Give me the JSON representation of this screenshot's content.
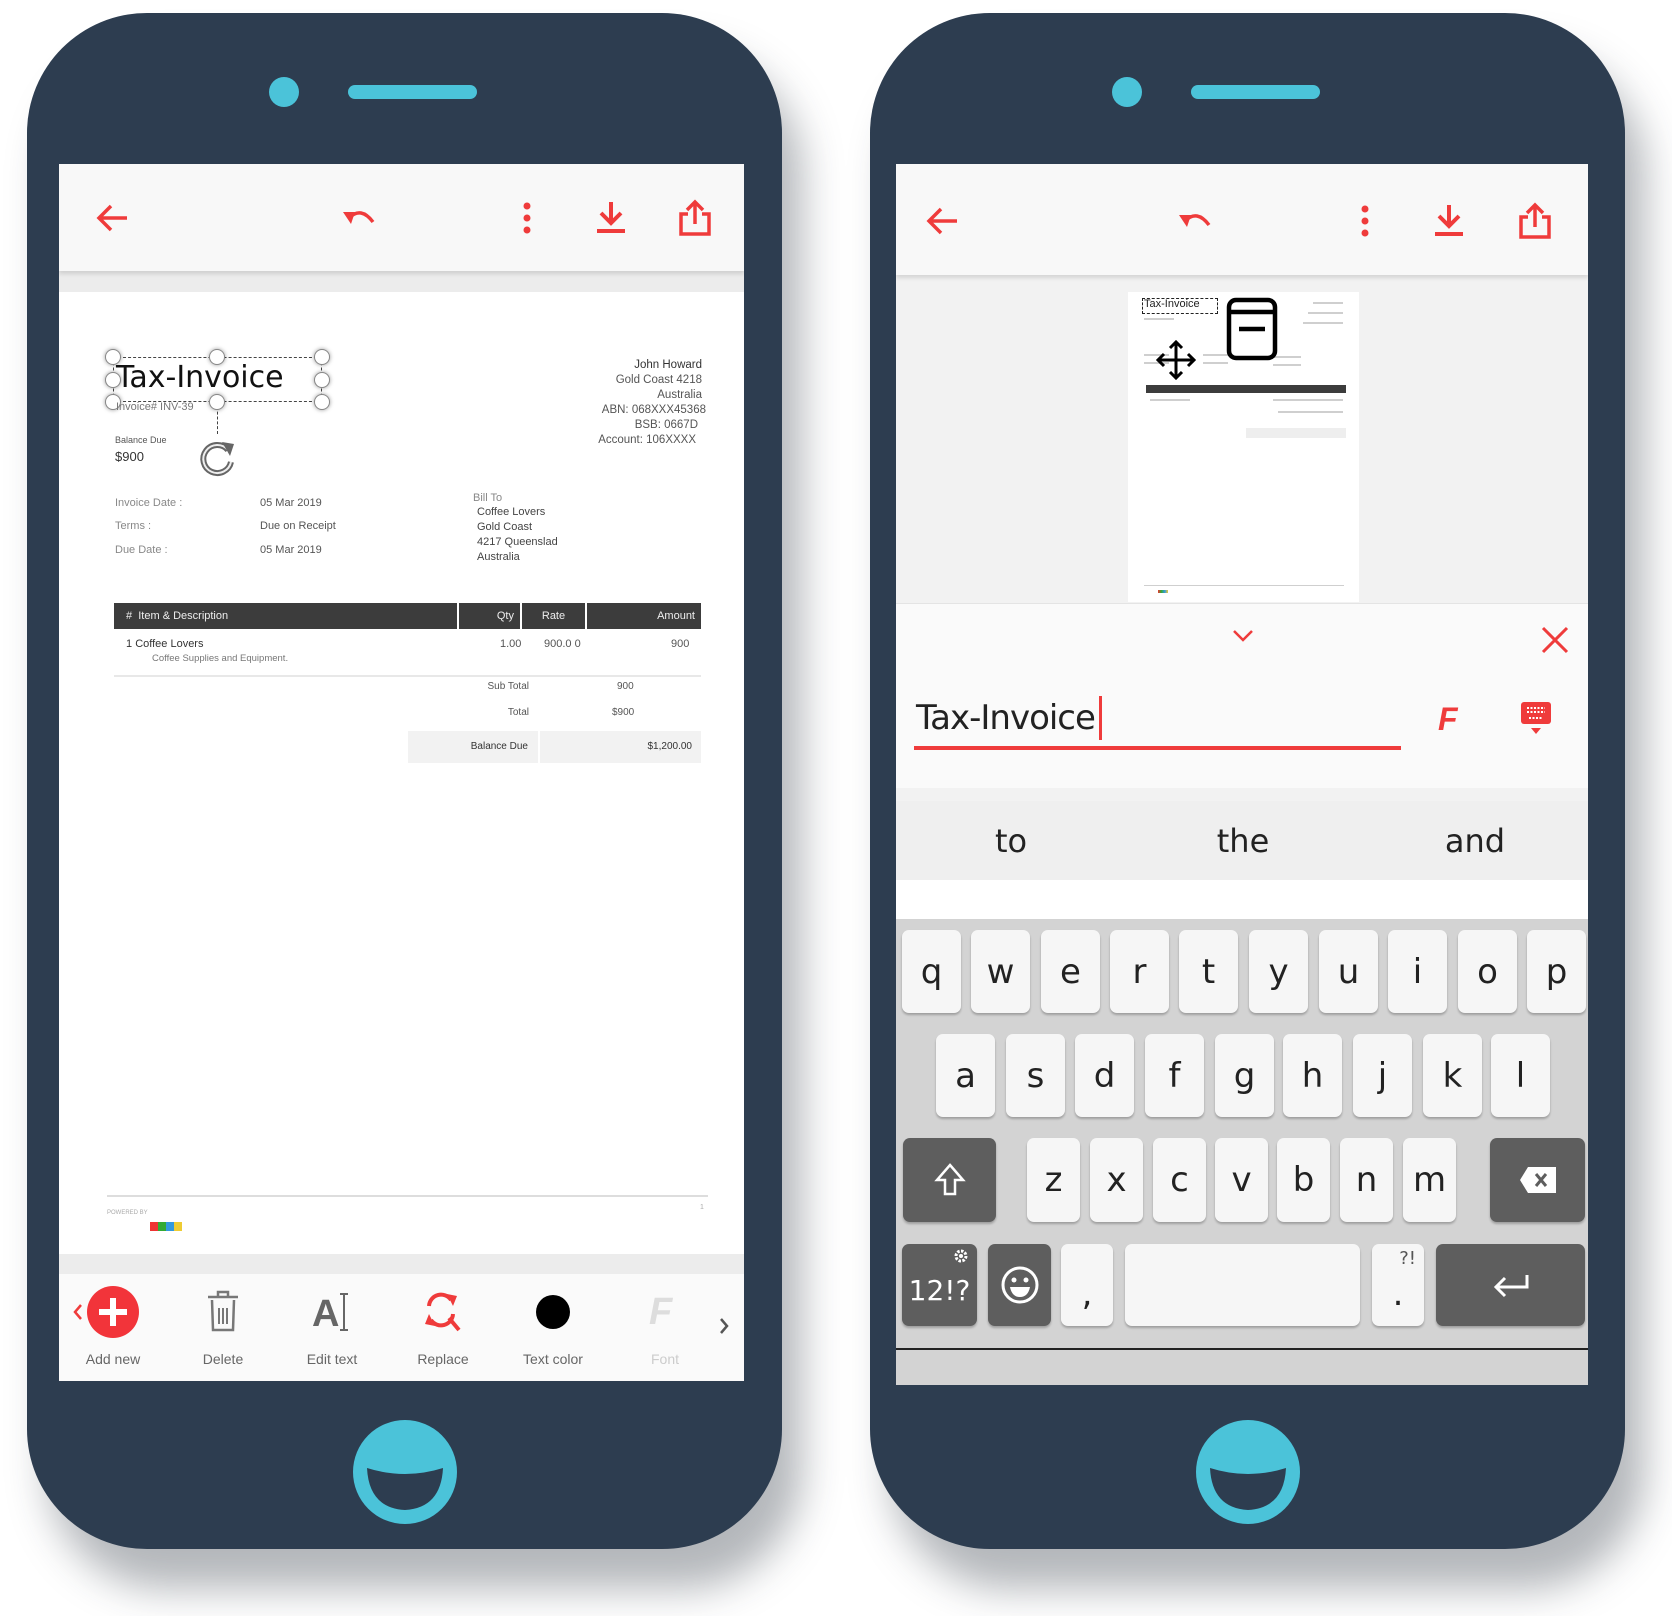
{
  "colors": {
    "accent": "#ef3b3b",
    "phone": "#2d3d50",
    "phone_accent": "#4bc3d9",
    "table_header": "#3c3c3c"
  },
  "toolbar": {
    "icons": [
      "back-arrow-icon",
      "undo-icon",
      "more-vertical-icon",
      "download-icon",
      "share-icon"
    ]
  },
  "invoice": {
    "title": "Tax-Invoice",
    "number": "Invoice# INV-39",
    "balance_label": "Balance Due",
    "balance_value": "$900",
    "address": [
      "John Howard",
      "Gold Coast  4218",
      "Australia",
      "ABN: 068XXX45368",
      "BSB: 0667D",
      "Account: 106XXXX"
    ],
    "meta": [
      {
        "label": "Invoice Date :",
        "value": "05 Mar 2019"
      },
      {
        "label": "Terms :",
        "value": "Due on Receipt"
      },
      {
        "label": "Due Date :",
        "value": "05 Mar 2019"
      }
    ],
    "bill_to_label": "Bill To",
    "bill_to": [
      "Coffee Lovers",
      "Gold Coast",
      "4217 Queenslad",
      "Australia"
    ],
    "table": {
      "headers": [
        "#",
        "Item & Description",
        "Qty",
        "Rate",
        "Amount"
      ],
      "rows": [
        {
          "num": "1",
          "item": "Coffee Lovers",
          "desc": "Coffee Supplies and Equipment.",
          "qty": "1.00",
          "rate": "900.0 0",
          "amount": "900"
        }
      ]
    },
    "sub_total_label": "Sub Total",
    "sub_total": "900",
    "total_label": "Total",
    "total": "$900",
    "balance_due_label": "Balance Due",
    "balance_due": "$1,200.00",
    "powered_by": "POWERED BY",
    "page_number": "1"
  },
  "bottom_toolbar": [
    {
      "label": "Add new",
      "icon": "add-circle-icon"
    },
    {
      "label": "Delete",
      "icon": "trash-icon"
    },
    {
      "label": "Edit text",
      "icon": "edit-text-icon"
    },
    {
      "label": "Replace",
      "icon": "replace-icon"
    },
    {
      "label": "Text color",
      "icon": "color-dot-icon",
      "color": "#000000"
    },
    {
      "label": "Font",
      "icon": "font-icon",
      "disabled": true
    }
  ],
  "editor": {
    "value": "Tax-Invoice"
  },
  "suggestions": [
    "to",
    "the",
    "and"
  ],
  "keyboard": {
    "rows": [
      [
        "q",
        "w",
        "e",
        "r",
        "t",
        "y",
        "u",
        "i",
        "o",
        "p"
      ],
      [
        "a",
        "s",
        "d",
        "f",
        "g",
        "h",
        "j",
        "k",
        "l"
      ],
      [
        "shift",
        "z",
        "x",
        "c",
        "v",
        "b",
        "n",
        "m",
        "backspace"
      ],
      [
        "12!?",
        "emoji",
        ",",
        "space",
        ".",
        "enter"
      ]
    ],
    "period_hint": "?!"
  }
}
